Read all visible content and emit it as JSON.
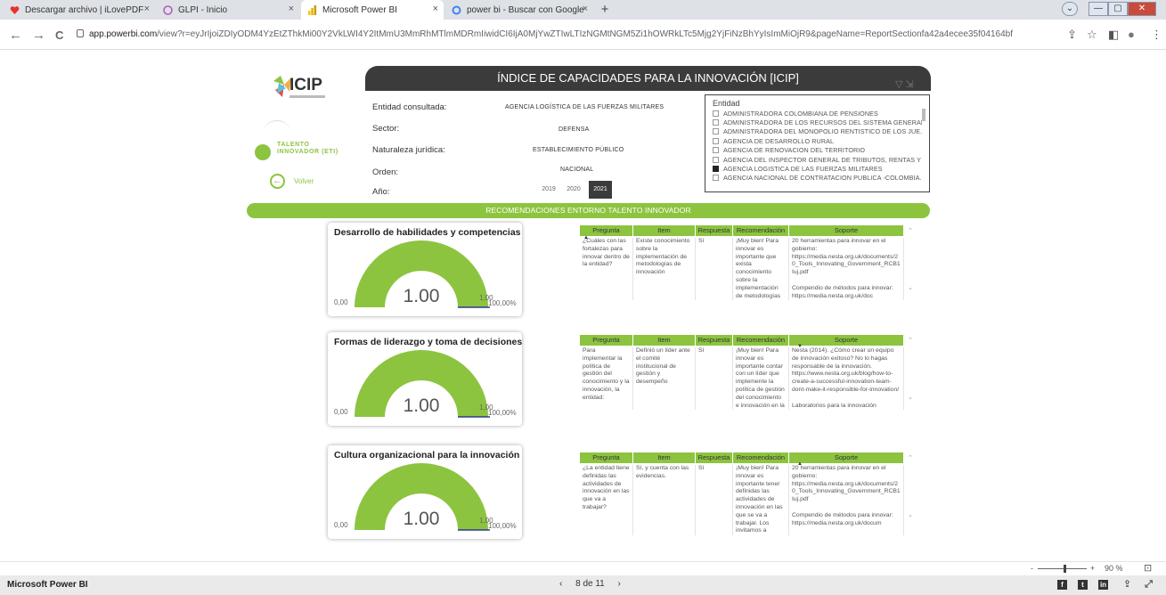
{
  "browser": {
    "tabs": [
      {
        "title": "Descargar archivo | iLovePDF",
        "close": "×"
      },
      {
        "title": "GLPI - Inicio",
        "close": "×"
      },
      {
        "title": "Microsoft Power BI",
        "close": "×"
      },
      {
        "title": "power bi - Buscar con Google",
        "close": "×"
      }
    ],
    "new_tab": "+",
    "url_host": "app.powerbi.com",
    "url_rest": "/view?r=eyJrIjoiZDIyODM4YzEtZThkMi00Y2VkLWI4Y2ItMmU3MmRhMTlmMDRmIiwidCI6IjA0MjYwZTIwLTIzNGMtNGM5Zi1hOWRkLTc5Mjg2YjFiNzBhYyIsImMiOjR9&pageName=ReportSectionfa42a4ecee35f04164bf",
    "back": "←",
    "forward": "→",
    "reload": "C",
    "share_icon": "⇪",
    "star_icon": "☆",
    "panel_icon": "◧",
    "profile_icon": "●",
    "menu_icon": "⋮",
    "win_controls": [
      "⌄",
      "—",
      "▢",
      "✕"
    ]
  },
  "report": {
    "logo": "ICIP",
    "title": "ÍNDICE DE CAPACIDADES PARA LA INNOVACIÓN [ICIP]",
    "filter_icons": "▽ ⇲",
    "info": {
      "entidad_label": "Entidad consultada:",
      "entidad_value": "AGENCIA LOGÍSTICA DE LAS FUERZAS MILITARES",
      "sector_label": "Sector:",
      "sector_value": "DEFENSA",
      "naturaleza_label": "Naturaleza jurídica:",
      "naturaleza_value": "ESTABLECIMIENTO PÚBLICO",
      "orden_label": "Orden:",
      "orden_value": "NACIONAL",
      "anio_label": "Año:",
      "years": [
        "2019",
        "2020",
        "2021"
      ],
      "selected_year": "2021"
    },
    "slicer": {
      "title": "Entidad",
      "items": [
        {
          "label": "ADMINISTRADORA COLOMBIANA DE PENSIONES",
          "checked": false
        },
        {
          "label": "ADMINISTRADORA DE LOS RECURSOS DEL SISTEMA GENERAL ...",
          "checked": false
        },
        {
          "label": "ADMINISTRADORA DEL MONOPOLIO RENTISTICO DE LOS JUE...",
          "checked": false
        },
        {
          "label": "AGENCIA DE DESARROLLO RURAL",
          "checked": false
        },
        {
          "label": "AGENCIA DE RENOVACION DEL TERRITORIO",
          "checked": false
        },
        {
          "label": "AGENCIA DEL INSPECTOR GENERAL DE TRIBUTOS, RENTAS Y C...",
          "checked": false
        },
        {
          "label": "AGENCIA LOGISTICA DE LAS FUERZAS MILITARES",
          "checked": true
        },
        {
          "label": "AGENCIA NACIONAL DE CONTRATACION PUBLICA -COLOMBIA...",
          "checked": false
        }
      ]
    },
    "side": {
      "talento_line1": "TALENTO",
      "talento_line2": "INNOVADOR (ETI)",
      "back_label": "Volver",
      "back_icon": "←"
    },
    "band": "RECOMENDACIONES ENTORNO TALENTO INNOVADOR",
    "gauges": [
      {
        "title": "Desarrollo de habilidades y competencias",
        "value_label": "1.00",
        "min": "0,00",
        "max": "1,00",
        "pct": "100,00%",
        "fill": 1.0
      },
      {
        "title": "Formas de liderazgo y toma de decisiones",
        "value_label": "1.00",
        "min": "0,00",
        "max": "1,00",
        "pct": "100,00%",
        "fill": 1.0
      },
      {
        "title": "Cultura organizacional para la innovación",
        "value_label": "1.00",
        "min": "0,00",
        "max": "1,00",
        "pct": "100,00%",
        "fill": 1.0
      }
    ],
    "table_headers": [
      "Pregunta",
      "Item",
      "Respuesta",
      "Recomendación",
      "Soporte"
    ],
    "tables": [
      {
        "pregunta": "¿Cuáles con las fortalezas para innovar dentro de la entidad?",
        "item": "Existe conocimiento sobre la implementación de metodologías de innovación",
        "respuesta": "Sí",
        "recomendacion": "¡Muy bien! Para innovar es importante que exista conocimiento sobre la implementación de metodologías",
        "soporte": "20 herramientas para innovar en el gobierno: https://media.nesta.org.uk/documents/20_Tools_Innovating_Government_RCB1Iuj.pdf\n\nCompendio de métodos para innovar: https://media.nesta.org.uk/doc"
      },
      {
        "pregunta": "Para implementar la política de gestión del conocimiento y la innovación, la entidad:",
        "item": "Definió un líder ante el comité institucional de gestión y desempeño",
        "respuesta": "Sí",
        "recomendacion": "¡Muy bien! Para innovar es importante contar con un líder que implemente la política de gestión del conocimiento e innovación en la",
        "soporte": "Nesta (2014). ¿Cómo crear un equipo de innovación exitoso? No lo hagas responsable de la innovación. https://www.nesta.org.uk/blog/how-to-create-a-successful-innovation-team-dont-make-it-responsible-for-innovation/\n\nLaboratorios para la innovación"
      },
      {
        "pregunta": "¿La entidad tiene definidas las actividades de innovación en las que va a trabajar?",
        "item": "Sí, y cuenta con las evidencias.",
        "respuesta": "Sí",
        "recomendacion": "¡Muy bien! Para innovar es importante tener definidas las actividades de innovación en las que se va a trabajar. Los invitamos a",
        "soporte": "20 herramientas para innovar en el gobierno: https://media.nesta.org.uk/documents/20_Tools_Innovating_Government_RCB1Iuj.pdf\n\nCompendio de métodos para innovar: https://media.nesta.org.uk/docum"
      }
    ]
  },
  "powerbi": {
    "brand": "Microsoft Power BI",
    "page_label": "8 de 11",
    "prev": "‹",
    "next": "›",
    "zoom_minus": "-",
    "zoom_plus": "+",
    "zoom": "90 %",
    "fit_icon": "⊡",
    "social": [
      "f",
      "t",
      "in",
      "⇪",
      "⤢"
    ]
  },
  "colors": {
    "accent": "#8cc43f",
    "dark": "#3b3b3b",
    "gauge_track": "#e6e6e6",
    "gauge_target": "#2f3a8f"
  }
}
